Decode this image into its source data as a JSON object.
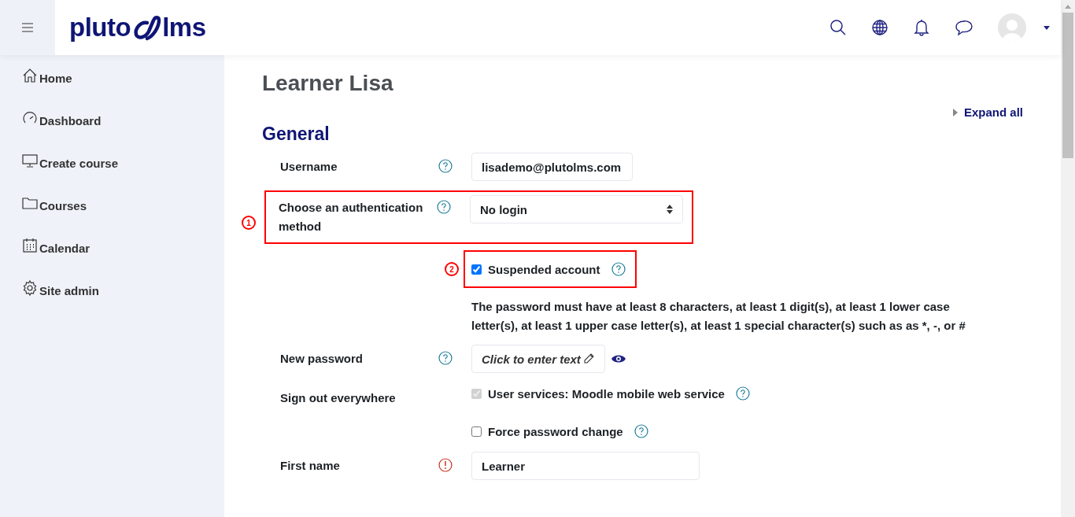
{
  "header": {
    "logo": {
      "left": "pluto",
      "right": "lms"
    }
  },
  "sidebar": {
    "items": [
      {
        "label": "Home",
        "kind": "home"
      },
      {
        "label": "Dashboard",
        "kind": "gauge"
      },
      {
        "label": "Create course",
        "kind": "monitor"
      },
      {
        "label": "Courses",
        "kind": "folder"
      },
      {
        "label": "Calendar",
        "kind": "calendar"
      },
      {
        "label": "Site admin",
        "kind": "gear"
      }
    ]
  },
  "page": {
    "title": "Learner Lisa",
    "expand_all": "Expand all",
    "section": "General"
  },
  "form": [
    {
      "kind": "text",
      "label": "Username",
      "required": false,
      "value": "lisademo@plutolms.com"
    },
    {
      "kind": "select",
      "label": "Choose an authentication method",
      "required": false,
      "value": "No login",
      "annotation": "1"
    },
    {
      "kind": "checkboxes",
      "options": [
        {
          "label": "Suspended account",
          "checked": true,
          "disabled": false,
          "annotation": "2"
        }
      ]
    },
    {
      "kind": "note",
      "text": "The password must have at least 8 characters, at least 1 digit(s), at least 1 lower case letter(s), at least 1 upper case letter(s), at least 1 special character(s) such as as *, -, or #"
    },
    {
      "kind": "password",
      "label": "New password",
      "required": false,
      "prompt": "Click to enter text"
    },
    {
      "kind": "checkboxes",
      "label": "Sign out everywhere",
      "options": [
        {
          "label": "User services: Moodle mobile web service",
          "checked": true,
          "disabled": true
        },
        {
          "label": "Force password change",
          "checked": false,
          "disabled": false
        }
      ]
    },
    {
      "kind": "text",
      "label": "First name",
      "required": true,
      "value": "Learner"
    }
  ]
}
